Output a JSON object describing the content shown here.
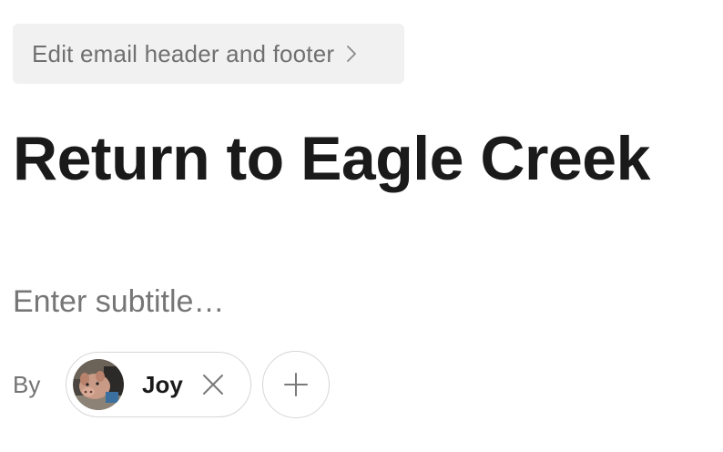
{
  "header_footer": {
    "label": "Edit email header and footer",
    "icon": "chevron-right-icon"
  },
  "post": {
    "title": "Return to Eagle Creek",
    "subtitle_placeholder": "Enter subtitle…",
    "subtitle_value": ""
  },
  "byline": {
    "by_label": "By",
    "authors": [
      {
        "name": "Joy",
        "avatar": "avatar-photo",
        "remove_icon": "close-icon"
      }
    ],
    "add_icon": "plus-icon"
  },
  "colors": {
    "button_bg": "#f1f1f1",
    "muted_text": "#737373",
    "title_text": "#1a1a1a",
    "chip_border": "#d6d6d6"
  }
}
